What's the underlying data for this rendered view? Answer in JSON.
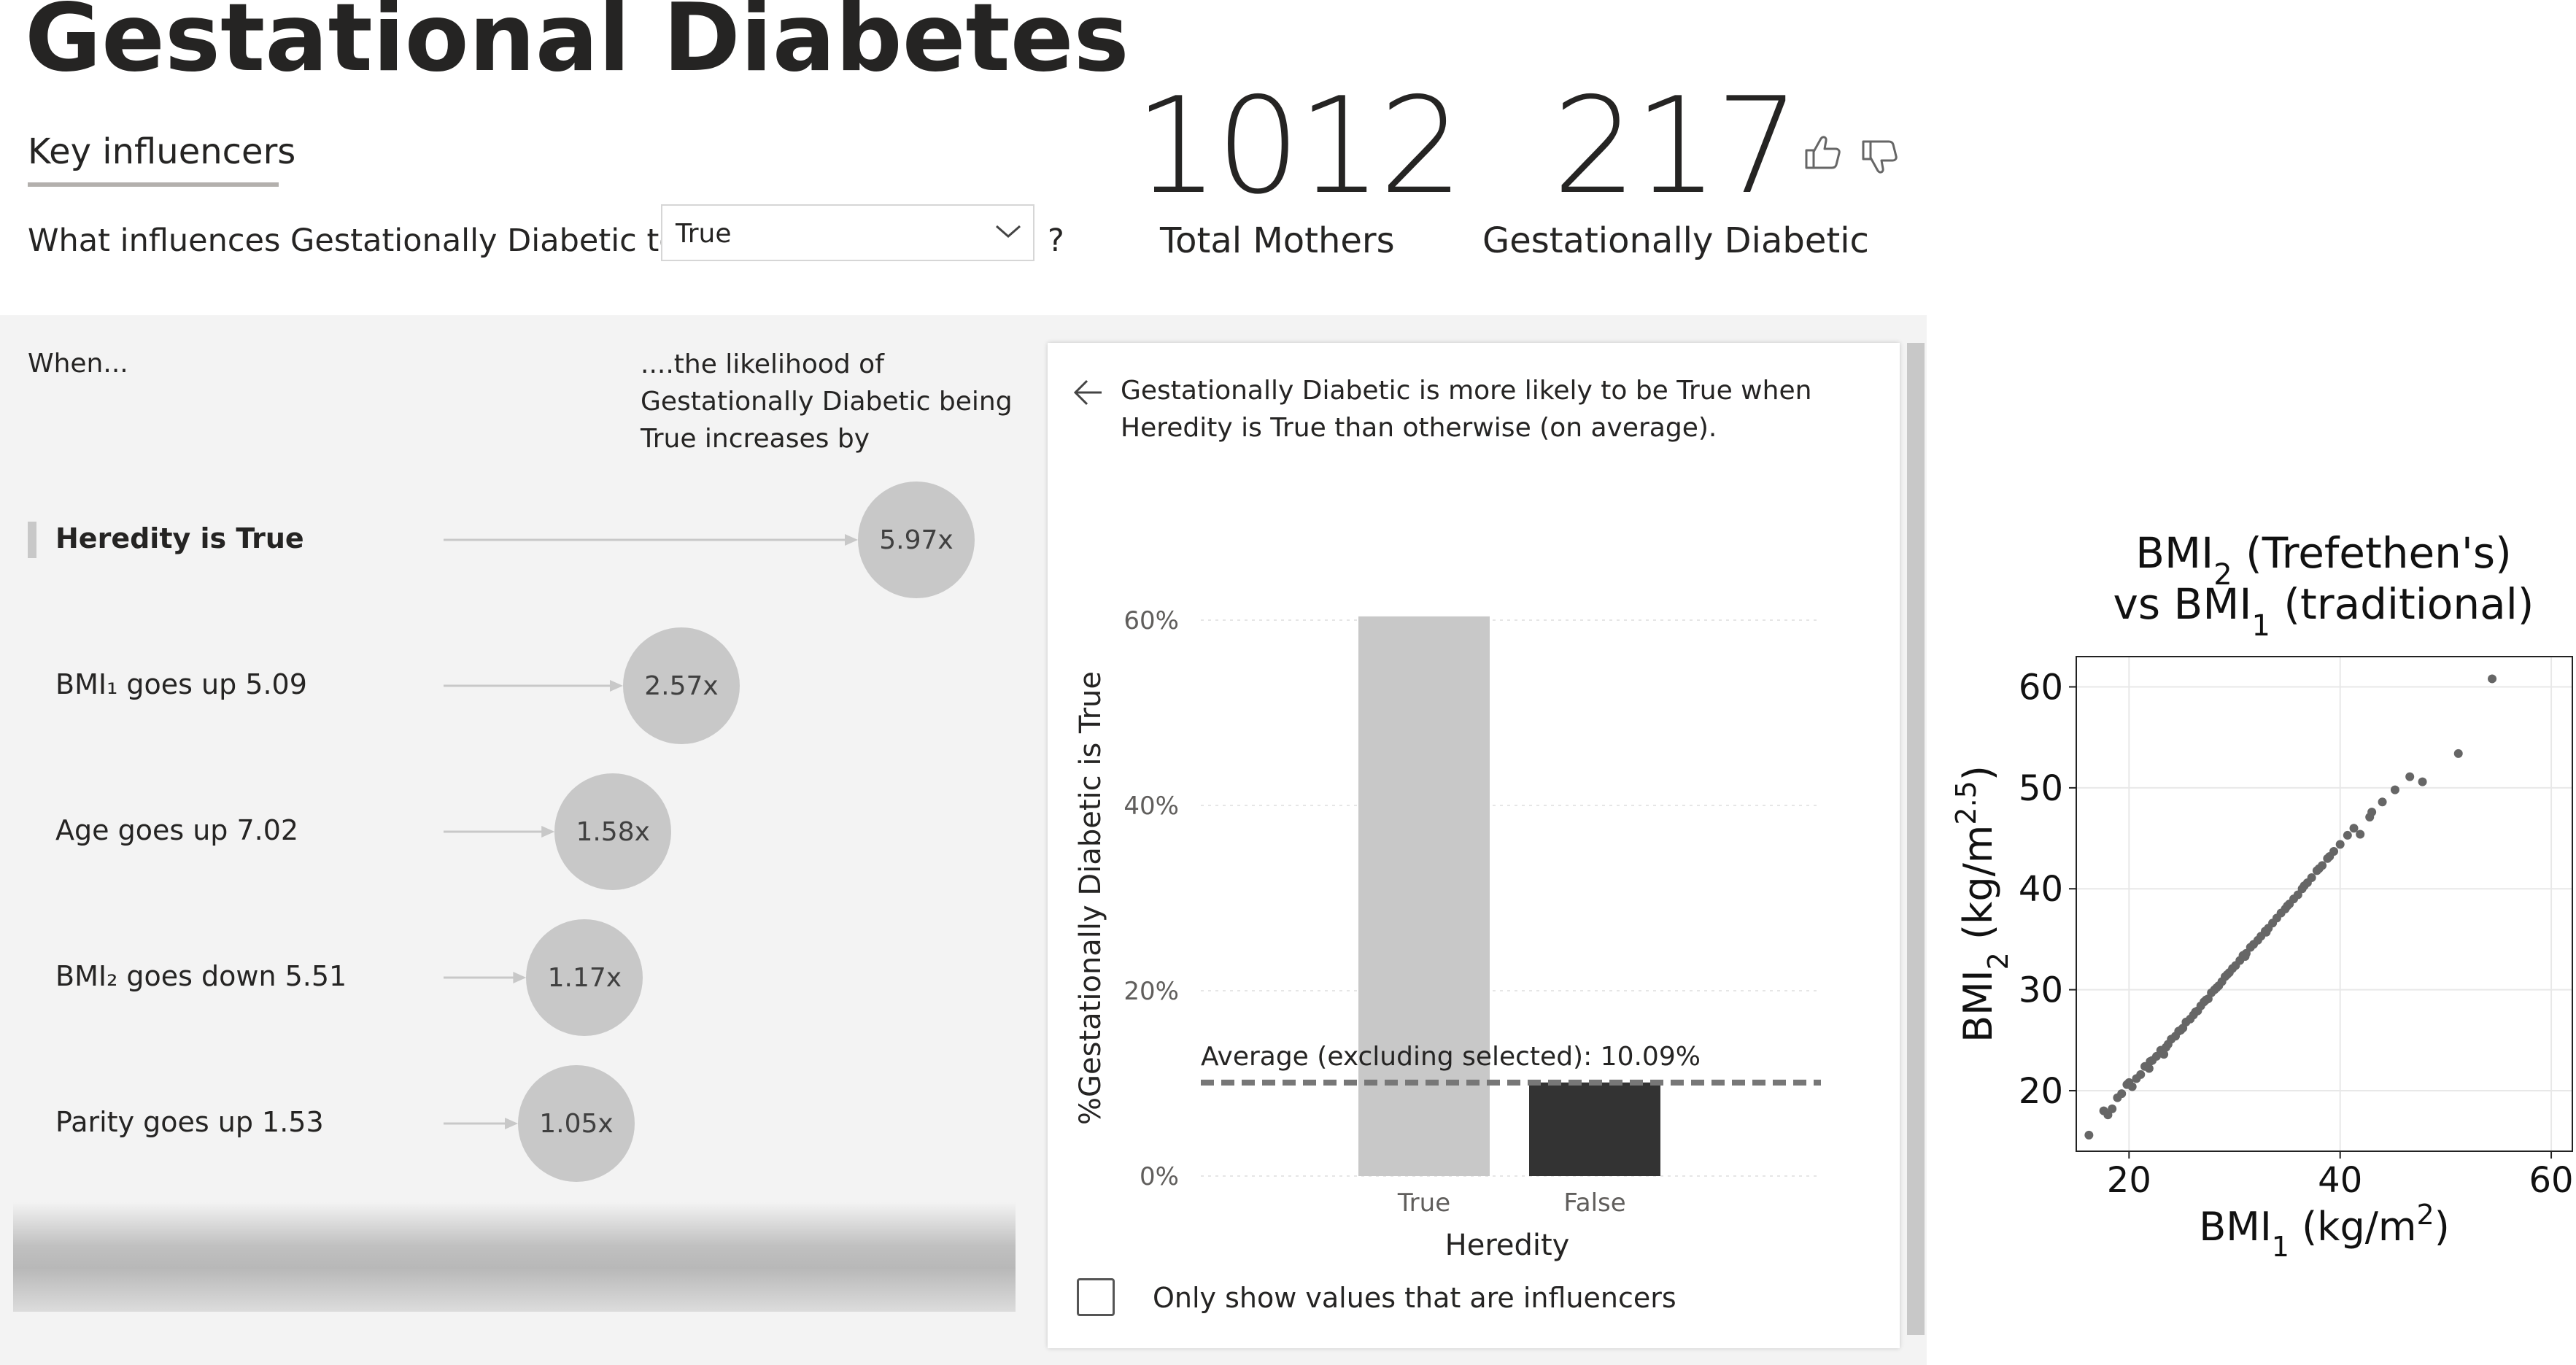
{
  "page_title": "Gestational Diabetes",
  "tab_label": "Key influencers",
  "question": {
    "prefix": "What influences Gestationally Diabetic to be",
    "selected_value": "True",
    "suffix": "?"
  },
  "kpis": [
    {
      "value": "1012",
      "label": "Total Mothers"
    },
    {
      "value": "217",
      "label": "Gestationally Diabetic"
    }
  ],
  "influencers": {
    "when_header": "When...",
    "likelihood_header": "....the likelihood of Gestationally Diabetic being True increases by",
    "rows": [
      {
        "label": "Heredity is True",
        "factor": "5.97x",
        "value": 5.97,
        "selected": true
      },
      {
        "label": "BMI₁ goes up 5.09",
        "factor": "2.57x",
        "value": 2.57,
        "selected": false
      },
      {
        "label": "Age goes up 7.02",
        "factor": "1.58x",
        "value": 1.58,
        "selected": false
      },
      {
        "label": "BMI₂ goes down 5.51",
        "factor": "1.17x",
        "value": 1.17,
        "selected": false
      },
      {
        "label": "Parity goes up 1.53",
        "factor": "1.05x",
        "value": 1.05,
        "selected": false
      }
    ]
  },
  "detail": {
    "description": "Gestationally Diabetic is more likely to be True when Heredity is True than otherwise (on average).",
    "checkbox_label": "Only show values that are influencers",
    "checkbox_checked": false
  },
  "chart_data": [
    {
      "type": "bar",
      "categories": [
        "True",
        "False"
      ],
      "values": [
        60.4,
        10.1
      ],
      "bar_colors": [
        "#c8c8c8",
        "#333333"
      ],
      "xlabel": "Heredity",
      "ylabel": "%Gestationally Diabetic is True",
      "yticks": [
        "0%",
        "20%",
        "40%",
        "60%"
      ],
      "ylim": [
        0,
        60
      ],
      "reference_line": {
        "value": 10.09,
        "label": "Average (excluding selected): 10.09%"
      }
    },
    {
      "type": "scatter",
      "title_parts": {
        "a": "BMI",
        "a_sub": "2",
        "a_rest": " (Trefethen's)",
        "b": "vs BMI",
        "b_sub": "1",
        "b_rest": " (traditional)"
      },
      "xlabel_parts": {
        "main": "BMI",
        "sub": "1",
        "rest": " (kg/m",
        "sup": "2",
        "end": ")"
      },
      "ylabel_parts": {
        "main": "BMI",
        "sub": "2",
        "rest": " (kg/m",
        "sup": "2.5",
        "end": ")"
      },
      "xlim": [
        15,
        62
      ],
      "ylim": [
        14,
        63
      ],
      "xticks": [
        20,
        40,
        60
      ],
      "yticks": [
        20,
        30,
        40,
        50,
        60
      ],
      "grid": true,
      "point_color": "#666666",
      "points": [
        [
          16.2,
          15.6
        ],
        [
          17.6,
          18.0
        ],
        [
          18.0,
          17.6
        ],
        [
          18.4,
          18.2
        ],
        [
          18.9,
          19.3
        ],
        [
          19.3,
          19.7
        ],
        [
          19.8,
          20.6
        ],
        [
          20.3,
          20.4
        ],
        [
          20.7,
          21.2
        ],
        [
          21.1,
          21.6
        ],
        [
          21.5,
          22.4
        ],
        [
          21.9,
          22.2
        ],
        [
          22.2,
          23.0
        ],
        [
          22.6,
          23.4
        ],
        [
          23.0,
          24.0
        ],
        [
          23.3,
          23.6
        ],
        [
          23.7,
          24.6
        ],
        [
          24.0,
          25.1
        ],
        [
          24.4,
          25.4
        ],
        [
          24.7,
          25.9
        ],
        [
          25.1,
          26.2
        ],
        [
          25.4,
          26.8
        ],
        [
          25.8,
          27.1
        ],
        [
          26.1,
          27.5
        ],
        [
          26.5,
          27.9
        ],
        [
          26.8,
          28.4
        ],
        [
          27.1,
          28.8
        ],
        [
          27.5,
          29.1
        ],
        [
          27.8,
          29.7
        ],
        [
          28.1,
          30.0
        ],
        [
          28.5,
          30.4
        ],
        [
          28.8,
          30.8
        ],
        [
          29.1,
          31.3
        ],
        [
          29.5,
          31.7
        ],
        [
          29.8,
          32.1
        ],
        [
          30.1,
          32.4
        ],
        [
          30.5,
          32.9
        ],
        [
          30.8,
          33.4
        ],
        [
          31.1,
          33.6
        ],
        [
          31.5,
          34.2
        ],
        [
          31.8,
          34.5
        ],
        [
          32.2,
          34.9
        ],
        [
          32.5,
          35.3
        ],
        [
          32.9,
          35.8
        ],
        [
          33.2,
          36.1
        ],
        [
          33.6,
          36.6
        ],
        [
          34.0,
          37.1
        ],
        [
          34.4,
          37.6
        ],
        [
          34.8,
          38.0
        ],
        [
          35.2,
          38.5
        ],
        [
          35.6,
          39.0
        ],
        [
          36.0,
          39.4
        ],
        [
          36.4,
          40.0
        ],
        [
          36.9,
          40.6
        ],
        [
          37.3,
          41.1
        ],
        [
          37.8,
          41.8
        ],
        [
          38.3,
          42.3
        ],
        [
          38.8,
          43.0
        ],
        [
          39.4,
          43.7
        ],
        [
          40.0,
          44.4
        ],
        [
          40.7,
          45.3
        ],
        [
          41.3,
          46.0
        ],
        [
          41.9,
          45.4
        ],
        [
          42.8,
          47.1
        ],
        [
          44.0,
          48.6
        ],
        [
          45.2,
          49.8
        ],
        [
          46.6,
          51.1
        ],
        [
          51.2,
          53.4
        ],
        [
          54.4,
          60.8
        ],
        [
          22.0,
          22.9
        ],
        [
          24.9,
          26.0
        ],
        [
          27.3,
          29.0
        ],
        [
          29.3,
          31.5
        ],
        [
          31.0,
          33.3
        ],
        [
          33.0,
          35.7
        ],
        [
          35.0,
          38.3
        ],
        [
          36.6,
          40.3
        ],
        [
          38.0,
          42.0
        ],
        [
          39.0,
          43.2
        ],
        [
          43.0,
          47.6
        ],
        [
          47.8,
          50.6
        ],
        [
          20.0,
          20.8
        ],
        [
          23.5,
          24.3
        ],
        [
          26.3,
          27.8
        ],
        [
          28.3,
          30.2
        ]
      ]
    }
  ]
}
